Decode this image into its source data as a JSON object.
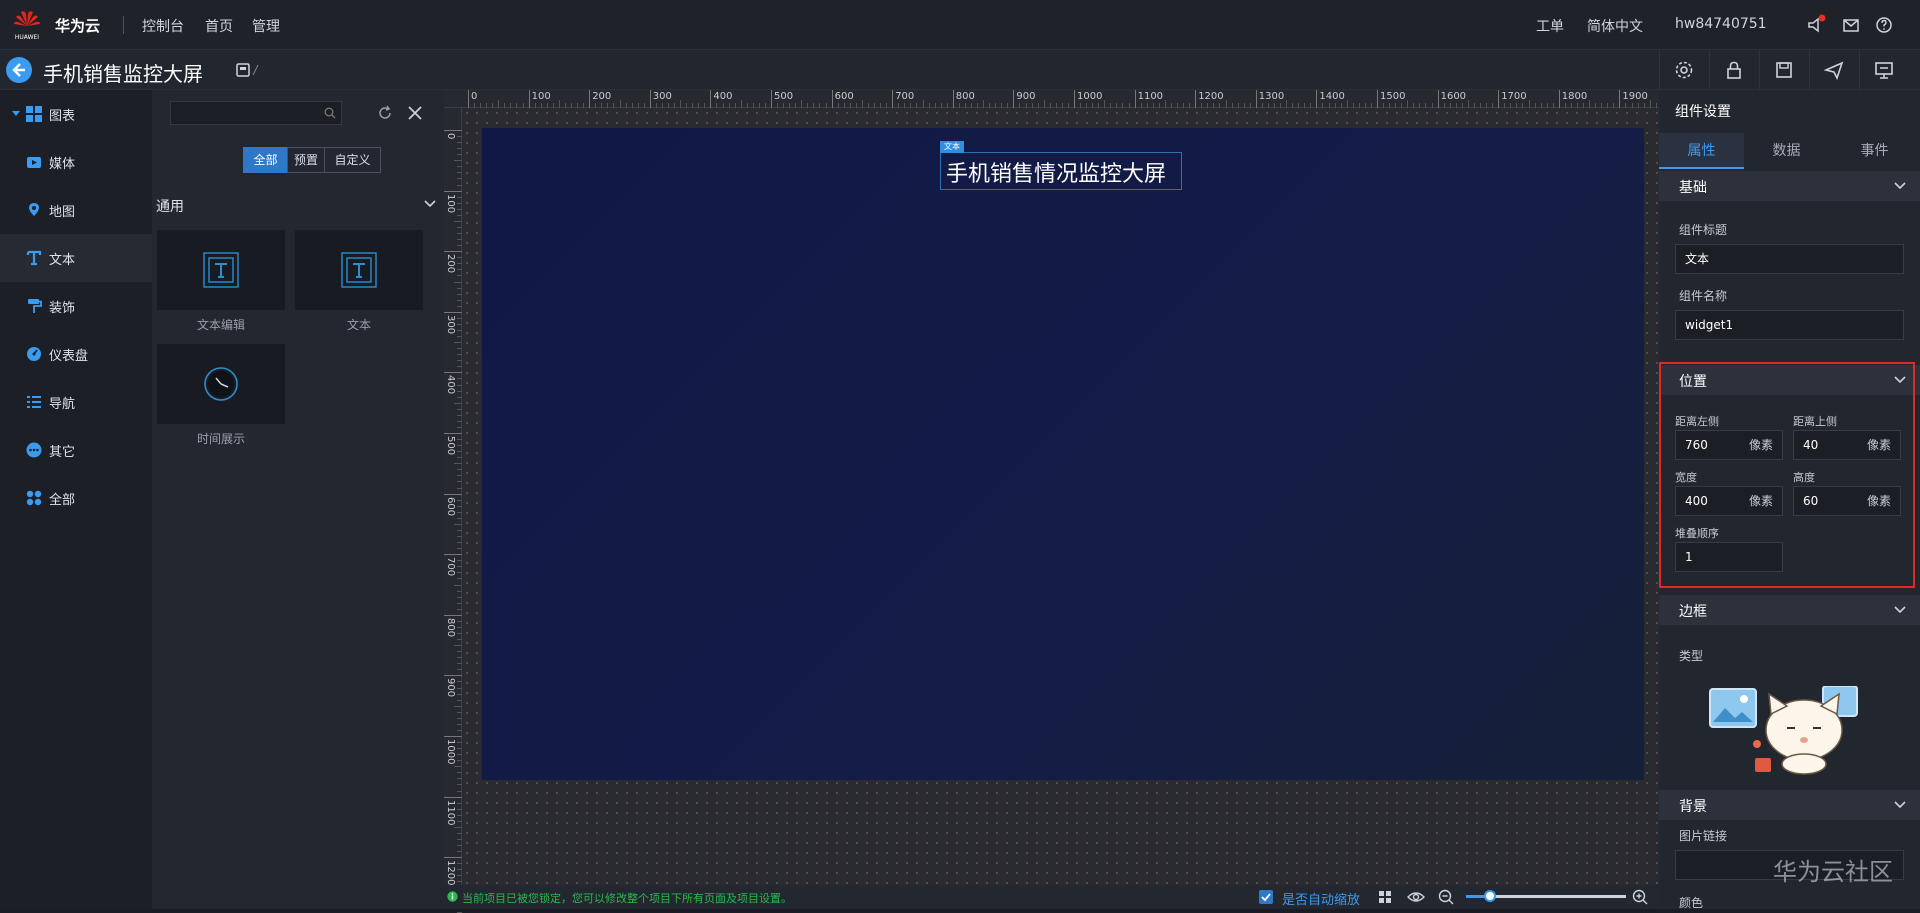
{
  "topbar": {
    "logo_text": "HUAWEI",
    "brand": "华为云",
    "nav": [
      "控制台",
      "首页",
      "管理"
    ],
    "right": [
      "工单",
      "简体中文",
      "hw84740751"
    ]
  },
  "subbar": {
    "title": "手机销售监控大屏"
  },
  "leftnav": {
    "items": [
      {
        "label": "图表",
        "icon": "chart-grid-icon"
      },
      {
        "label": "媒体",
        "icon": "media-icon"
      },
      {
        "label": "地图",
        "icon": "map-pin-icon"
      },
      {
        "label": "文本",
        "icon": "text-icon"
      },
      {
        "label": "装饰",
        "icon": "paint-roller-icon"
      },
      {
        "label": "仪表盘",
        "icon": "gauge-icon"
      },
      {
        "label": "导航",
        "icon": "list-icon"
      },
      {
        "label": "其它",
        "icon": "more-icon"
      },
      {
        "label": "全部",
        "icon": "apps-icon"
      }
    ]
  },
  "library": {
    "search_placeholder": "",
    "filters": [
      "全部",
      "预置",
      "自定义"
    ],
    "section": "通用",
    "items": [
      "文本编辑",
      "文本",
      "时间展示"
    ]
  },
  "canvas": {
    "h_ticks": [
      "0",
      "100",
      "200",
      "300",
      "400",
      "500",
      "600",
      "700",
      "800",
      "900",
      "1000",
      "1100",
      "1200",
      "1300",
      "1400",
      "1500",
      "1600",
      "1700",
      "1800",
      "1900"
    ],
    "v_ticks": [
      "0",
      "100",
      "200",
      "300",
      "400",
      "500",
      "600",
      "700",
      "800",
      "900",
      "1000",
      "1100",
      "1200"
    ],
    "widget_tag": "文本",
    "widget_text": "手机销售情况监控大屏"
  },
  "statusbar": {
    "lock_notice": "当前项目已被您锁定，您可以修改整个项目下所有页面及项目设置。",
    "auto_zoom_label": "是否自动缩放",
    "auto_zoom_checked": true,
    "zoom_level": 0.15
  },
  "settings": {
    "title": "组件设置",
    "tabs": [
      "属性",
      "数据",
      "事件"
    ],
    "basic": {
      "header": "基础",
      "title_label": "组件标题",
      "title_value": "文本",
      "name_label": "组件名称",
      "name_value": "widget1"
    },
    "position": {
      "header": "位置",
      "left_label": "距离左侧",
      "left_value": "760",
      "top_label": "距离上侧",
      "top_value": "40",
      "width_label": "宽度",
      "width_value": "400",
      "height_label": "高度",
      "height_value": "60",
      "unit": "像素",
      "z_label": "堆叠顺序",
      "z_value": "1"
    },
    "border": {
      "header": "边框",
      "type_label": "类型"
    },
    "background": {
      "header": "背景",
      "image_label": "图片链接",
      "color_label": "颜色"
    }
  },
  "watermark": "华为云社区",
  "colors": {
    "accent": "#3a9bf0",
    "highlight": "#e02a2a"
  }
}
